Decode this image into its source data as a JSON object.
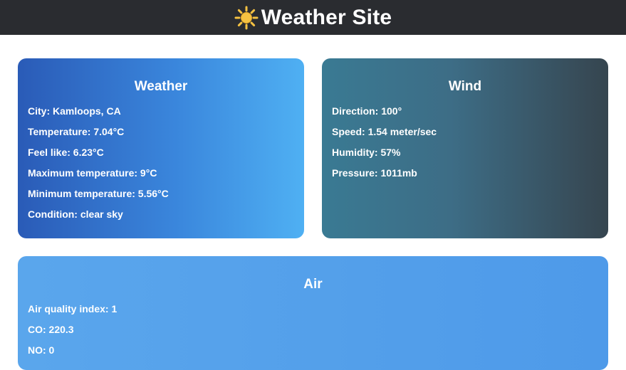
{
  "header": {
    "title": "Weather Site",
    "icon": "sun-icon"
  },
  "weather": {
    "title": "Weather",
    "rows": [
      "City: Kamloops, CA",
      "Temperature: 7.04°C",
      "Feel like: 6.23°C",
      "Maximum temperature: 9°C",
      "Minimum temperature: 5.56°C",
      "Condition: clear sky"
    ]
  },
  "wind": {
    "title": "Wind",
    "rows": [
      "Direction: 100°",
      "Speed: 1.54 meter/sec",
      "Humidity: 57%",
      "Pressure: 1011mb"
    ]
  },
  "air": {
    "title": "Air",
    "rows": [
      "Air quality index: 1",
      "CO: 220.3",
      "NO: 0"
    ]
  },
  "colors": {
    "header_bg": "#2a2c30",
    "weather_gradient_start": "#2a5bb7",
    "weather_gradient_end": "#4fb0f3",
    "wind_gradient_start": "#3a7a93",
    "wind_gradient_end": "#36454f",
    "air_bg": "#5aa6ec",
    "sun": "#f5c242"
  }
}
